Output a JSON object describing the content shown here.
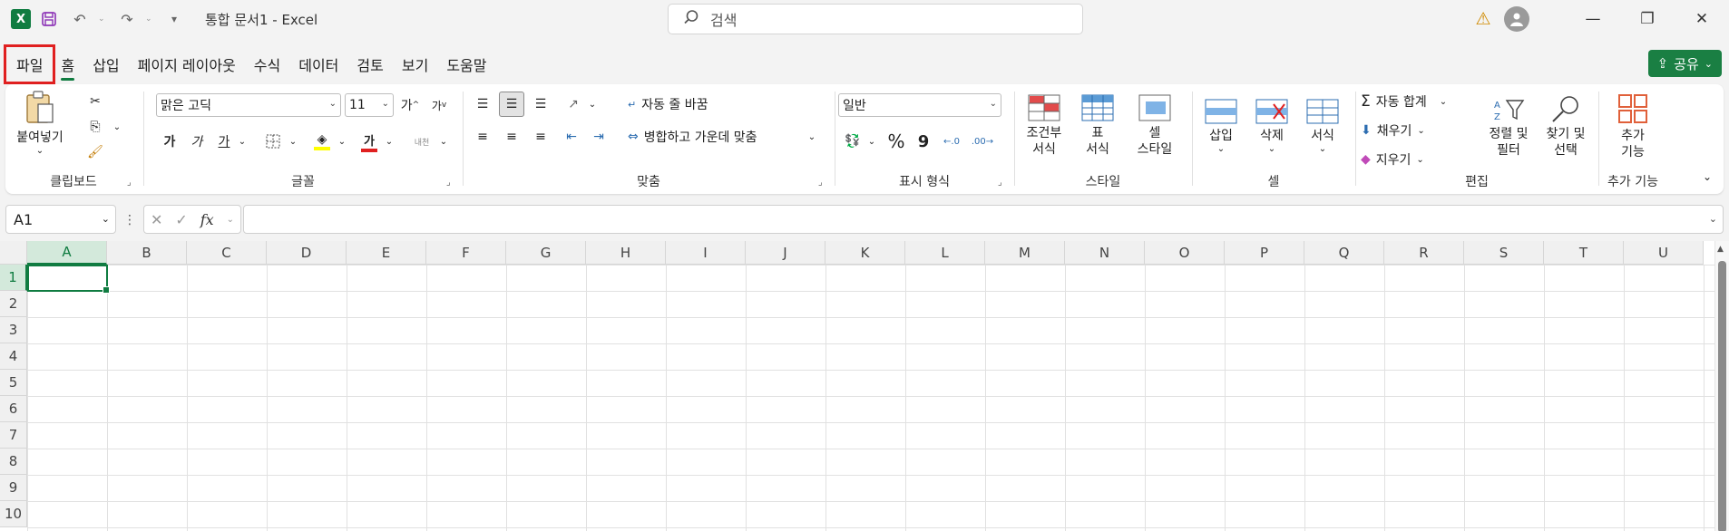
{
  "titlebar": {
    "app_logo": "X",
    "doc_title": "통합 문서1  -  Excel",
    "search_placeholder": "검색"
  },
  "menu": {
    "tabs": [
      "파일",
      "홈",
      "삽입",
      "페이지 레이아웃",
      "수식",
      "데이터",
      "검토",
      "보기",
      "도움말"
    ],
    "active": "홈",
    "highlighted": "파일",
    "share_label": "공유"
  },
  "ribbon": {
    "clipboard": {
      "paste": "붙여넣기",
      "label": "클립보드"
    },
    "font": {
      "family": "맑은 고딕",
      "size": "11",
      "grow": "가",
      "shrink": "가",
      "bold": "가",
      "italic": "가",
      "underline": "가",
      "font_color": "가",
      "phonetic": "내천",
      "label": "글꼴"
    },
    "alignment": {
      "wrap": "자동 줄 바꿈",
      "merge": "병합하고 가운데 맞춤",
      "label": "맞춤"
    },
    "number": {
      "format": "일반",
      "percent": "%",
      "comma": "9",
      "label": "표시 형식"
    },
    "styles": {
      "conditional_line1": "조건부",
      "conditional_line2": "서식",
      "table_line1": "표",
      "table_line2": "서식",
      "cell_line1": "셀",
      "cell_line2": "스타일",
      "label": "스타일"
    },
    "cells": {
      "insert": "삽입",
      "delete": "삭제",
      "format": "서식",
      "label": "셀"
    },
    "editing": {
      "autosum": "자동 합계",
      "fill": "채우기",
      "clear": "지우기",
      "sort_line1": "정렬 및",
      "sort_line2": "필터",
      "find_line1": "찾기 및",
      "find_line2": "선택",
      "label": "편집"
    },
    "addins": {
      "line1": "추가",
      "line2": "기능",
      "label": "추가 기능"
    }
  },
  "formula": {
    "name_box": "A1",
    "fx": "fx",
    "value": ""
  },
  "grid": {
    "columns": [
      "A",
      "B",
      "C",
      "D",
      "E",
      "F",
      "G",
      "H",
      "I",
      "J",
      "K",
      "L",
      "M",
      "N",
      "O",
      "P",
      "Q",
      "R",
      "S",
      "T",
      "U"
    ],
    "rows": [
      "1",
      "2",
      "3",
      "4",
      "5",
      "6",
      "7",
      "8",
      "9",
      "10"
    ],
    "selected_cell": "A1"
  },
  "colors": {
    "accent": "#107c41",
    "highlight": "#e02020"
  }
}
